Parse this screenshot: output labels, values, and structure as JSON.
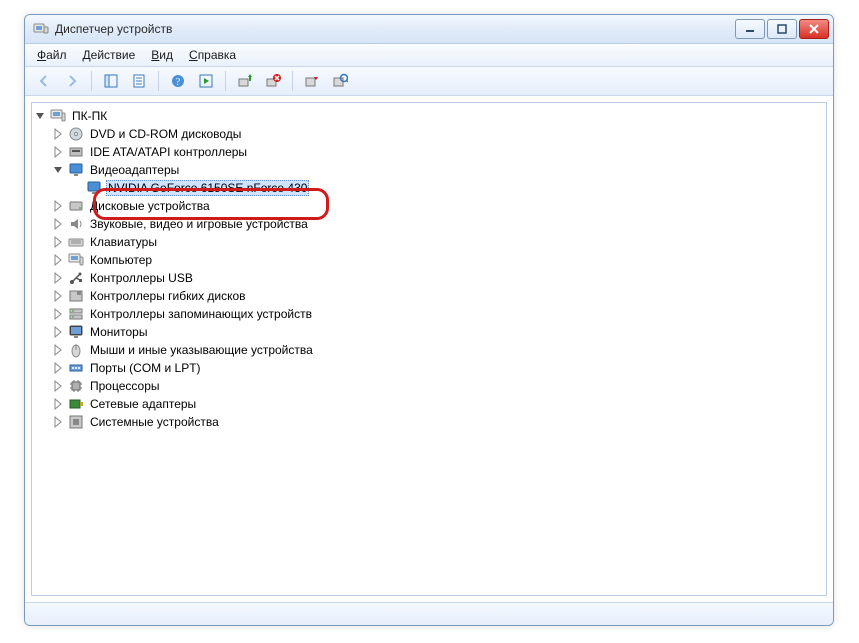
{
  "window": {
    "title": "Диспетчер устройств"
  },
  "menubar": {
    "file": {
      "char": "Ф",
      "rest": "айл"
    },
    "action": {
      "char": "Д",
      "rest": "ействие"
    },
    "view": {
      "char": "В",
      "rest": "ид"
    },
    "help": {
      "char": "С",
      "rest": "правка"
    }
  },
  "tree": {
    "root": "ПК-ПК",
    "items": [
      {
        "label": "DVD и CD-ROM дисководы",
        "icon": "disc"
      },
      {
        "label": "IDE ATA/ATAPI контроллеры",
        "icon": "ide"
      },
      {
        "label": "Видеоадаптеры",
        "icon": "display",
        "expanded": true,
        "children": [
          {
            "label": "NVIDIA GeForce 6150SE nForce 430",
            "icon": "display",
            "selected": true
          }
        ]
      },
      {
        "label": "Дисковые устройства",
        "icon": "hdd"
      },
      {
        "label": "Звуковые, видео и игровые устройства",
        "icon": "sound"
      },
      {
        "label": "Клавиатуры",
        "icon": "keyboard"
      },
      {
        "label": "Компьютер",
        "icon": "computer"
      },
      {
        "label": "Контроллеры USB",
        "icon": "usb"
      },
      {
        "label": "Контроллеры гибких дисков",
        "icon": "fdc"
      },
      {
        "label": "Контроллеры запоминающих устройств",
        "icon": "storage"
      },
      {
        "label": "Мониторы",
        "icon": "monitor"
      },
      {
        "label": "Мыши и иные указывающие устройства",
        "icon": "mouse"
      },
      {
        "label": "Порты (COM и LPT)",
        "icon": "port"
      },
      {
        "label": "Процессоры",
        "icon": "cpu"
      },
      {
        "label": "Сетевые адаптеры",
        "icon": "nic"
      },
      {
        "label": "Системные устройства",
        "icon": "system"
      }
    ]
  }
}
